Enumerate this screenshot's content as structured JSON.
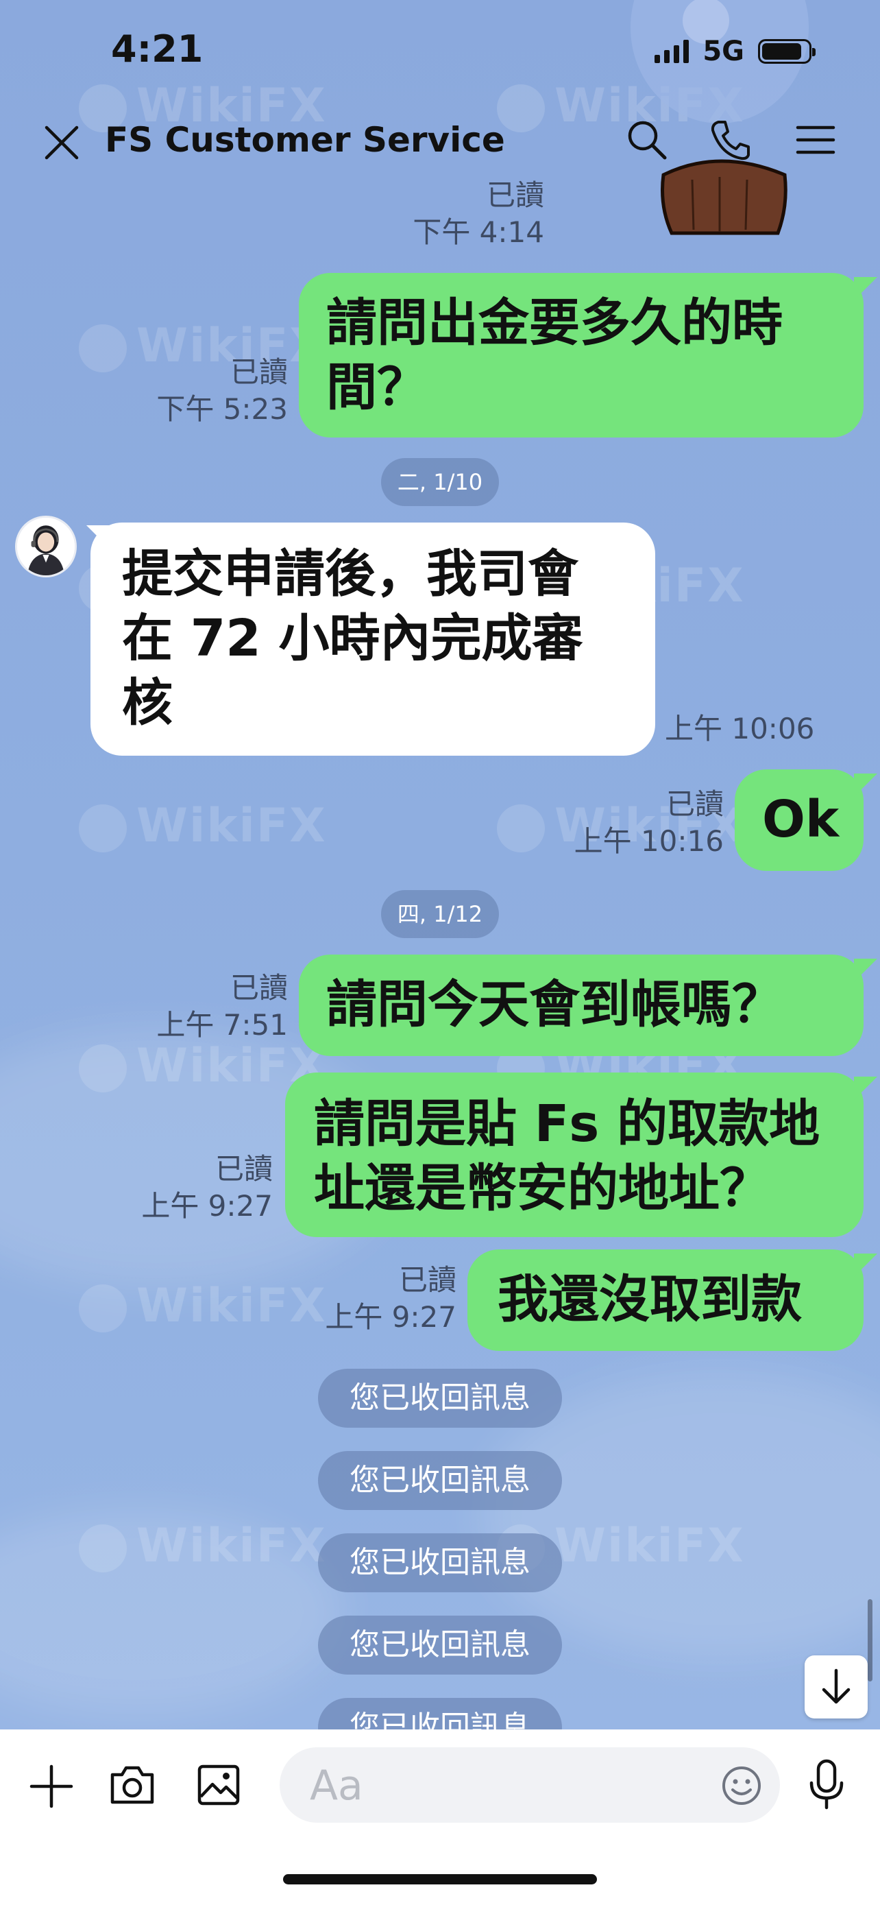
{
  "status_bar": {
    "time": "4:21",
    "network": "5G"
  },
  "header": {
    "title": "FS Customer Service"
  },
  "watermark_text": "WikiFX",
  "messages_top": {
    "read": "已讀",
    "time": "下午 4:14"
  },
  "messages": [
    {
      "id": "m1",
      "side": "out",
      "lines": [
        "請問出金要多久的時",
        "間？"
      ],
      "read": "已讀",
      "time": "下午 5:23"
    },
    {
      "id": "d1",
      "type": "date",
      "label": "二, 1/10"
    },
    {
      "id": "m2",
      "side": "in",
      "lines": [
        "提交申請後，我司會",
        "在 72 小時內完成審",
        "核"
      ],
      "time": "上午 10:06"
    },
    {
      "id": "m3",
      "side": "out",
      "lines": [
        "Ok"
      ],
      "read": "已讀",
      "time": "上午 10:16"
    },
    {
      "id": "d2",
      "type": "date",
      "label": "四, 1/12"
    },
    {
      "id": "m4",
      "side": "out",
      "lines": [
        "請問今天會到帳嗎？"
      ],
      "read": "已讀",
      "time": "上午 7:51"
    },
    {
      "id": "m5",
      "side": "out",
      "lines": [
        "請問是貼 Fs 的取款地",
        "址還是幣安的地址？"
      ],
      "read": "已讀",
      "time": "上午 9:27"
    },
    {
      "id": "m6",
      "side": "out",
      "lines": [
        "我還沒取到款"
      ],
      "read": "已讀",
      "time": "上午 9:27"
    }
  ],
  "recalled_notices": [
    "您已收回訊息",
    "您已收回訊息",
    "您已收回訊息",
    "您已收回訊息",
    "您已收回訊息"
  ],
  "input": {
    "placeholder": "Aa"
  },
  "colors": {
    "background": "#8ba9dd",
    "outgoing_bubble": "#75e47c",
    "incoming_bubble": "#ffffff",
    "system_chip": "#6882b2"
  },
  "icons": [
    "close-icon",
    "search-icon",
    "phone-icon",
    "menu-icon",
    "plus-icon",
    "camera-icon",
    "image-icon",
    "emoji-icon",
    "mic-icon",
    "arrow-down-icon"
  ]
}
